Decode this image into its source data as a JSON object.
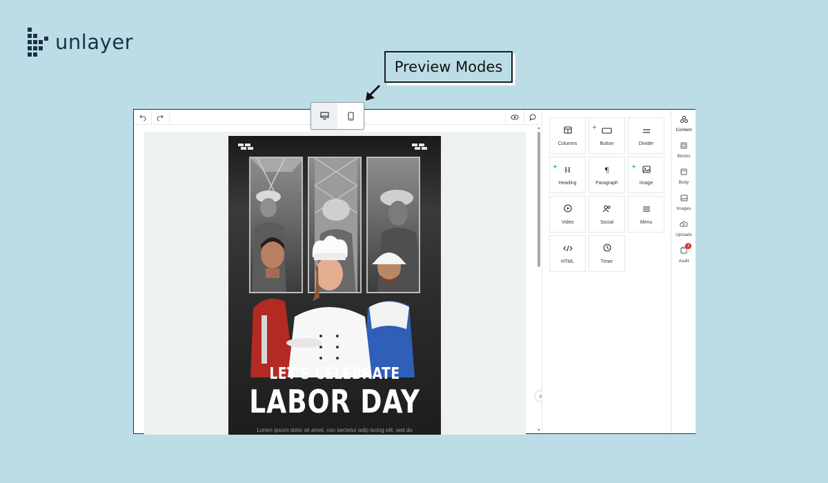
{
  "logo": {
    "text": "unlayer",
    "icon": "unlayer-logo-icon"
  },
  "callout": {
    "label": "Preview Modes",
    "icon": "arrow-down-left-icon"
  },
  "toolbar": {
    "undo_icon": "undo-icon",
    "redo_icon": "redo-icon",
    "preview_icon": "eye-icon",
    "comment_icon": "comment-icon",
    "preview_modes": [
      {
        "icon": "desktop-icon",
        "active": true
      },
      {
        "icon": "mobile-icon",
        "active": false
      }
    ]
  },
  "poster": {
    "headline_small": "LET'S CELEBRATE",
    "headline_large": "LABOR DAY",
    "body": "Lorem ipsum dolor sit amet, con sectetur adip iscing elit, sed do"
  },
  "tools": [
    {
      "label": "Columns",
      "icon": "columns-icon",
      "new": false
    },
    {
      "label": "Button",
      "icon": "button-icon",
      "new": true
    },
    {
      "label": "Divider",
      "icon": "divider-icon",
      "new": false
    },
    {
      "label": "Heading",
      "icon": "heading-icon",
      "new": true
    },
    {
      "label": "Paragraph",
      "icon": "paragraph-icon",
      "new": false
    },
    {
      "label": "Image",
      "icon": "image-icon",
      "new": true
    },
    {
      "label": "Video",
      "icon": "video-icon",
      "new": false
    },
    {
      "label": "Social",
      "icon": "social-icon",
      "new": false
    },
    {
      "label": "Menu",
      "icon": "menu-icon",
      "new": false
    },
    {
      "label": "HTML",
      "icon": "html-icon",
      "new": false
    },
    {
      "label": "Timer",
      "icon": "timer-icon",
      "new": false
    }
  ],
  "side_tabs": [
    {
      "label": "Content",
      "icon": "content-icon",
      "active": true
    },
    {
      "label": "Blocks",
      "icon": "blocks-icon",
      "active": false
    },
    {
      "label": "Body",
      "icon": "body-icon",
      "active": false
    },
    {
      "label": "Images",
      "icon": "images-icon",
      "active": false
    },
    {
      "label": "Uploads",
      "icon": "uploads-icon",
      "active": false
    },
    {
      "label": "Audit",
      "icon": "audit-icon",
      "active": false,
      "badge": "3"
    }
  ],
  "colors": {
    "background": "#bcdde6",
    "brand": "#1e3049",
    "spark": "#2bb673",
    "badge": "#d32f2f"
  }
}
